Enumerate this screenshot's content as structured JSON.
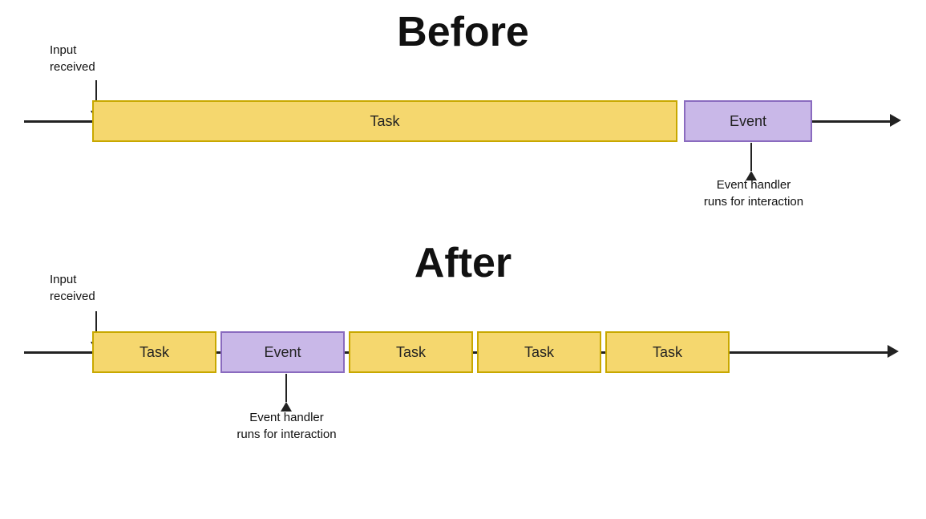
{
  "before": {
    "title": "Before",
    "input_label": "Input\nreceived",
    "task_label": "Task",
    "event_label": "Event",
    "annotation_label": "Event handler\nruns for interaction"
  },
  "after": {
    "title": "After",
    "input_label": "Input\nreceived",
    "task_label": "Task",
    "event_label": "Event",
    "task2_label": "Task",
    "task3_label": "Task",
    "task4_label": "Task",
    "annotation_label": "Event handler\nruns for interaction"
  }
}
